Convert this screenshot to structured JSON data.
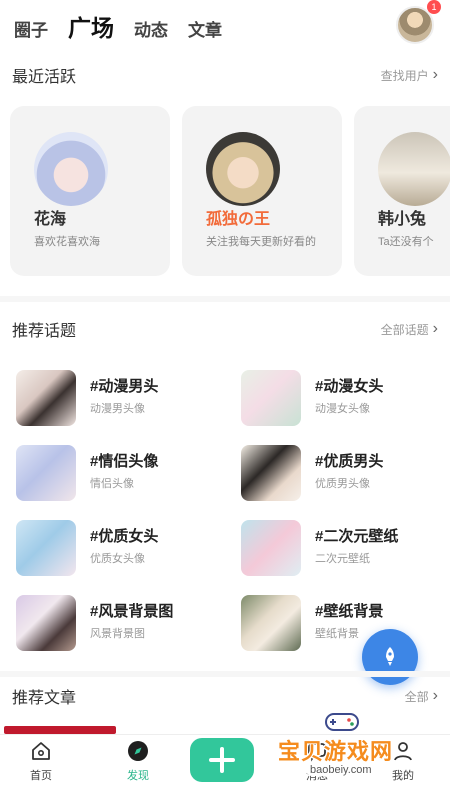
{
  "header": {
    "tabs": [
      "圈子",
      "广场",
      "动态",
      "文章"
    ],
    "active_tab": "广场",
    "notification_count": "1"
  },
  "recent": {
    "title": "最近活跃",
    "more": "查找用户",
    "users": [
      {
        "name": "花海",
        "desc": "喜欢花喜欢海",
        "highlight": false
      },
      {
        "name": "孤独の王",
        "desc": "关注我每天更新好看的",
        "highlight": true
      },
      {
        "name": "韩小兔",
        "desc": "Ta还没有个",
        "highlight": false
      }
    ]
  },
  "topics": {
    "title": "推荐话题",
    "more": "全部话题",
    "items": [
      {
        "title": "#动漫男头",
        "sub": "动漫男头像"
      },
      {
        "title": "#动漫女头",
        "sub": "动漫女头像"
      },
      {
        "title": "#情侣头像",
        "sub": "情侣头像"
      },
      {
        "title": "#优质男头",
        "sub": "优质男头像"
      },
      {
        "title": "#优质女头",
        "sub": "优质女头像"
      },
      {
        "title": "#二次元壁纸",
        "sub": "二次元壁纸"
      },
      {
        "title": "#风景背景图",
        "sub": "风景背景图"
      },
      {
        "title": "#壁纸背景",
        "sub": "壁纸背景"
      }
    ]
  },
  "articles": {
    "title": "推荐文章",
    "more": "全部"
  },
  "nav": {
    "home": "首页",
    "discover": "发现",
    "messages": "消息",
    "mine": "我的"
  },
  "watermark": {
    "name": "宝贝游戏网",
    "url": "baobeiy.com"
  },
  "colors": {
    "accent": "#32c79b",
    "highlight_name": "#f26b3a",
    "fab": "#3d86e6",
    "watermark": "#f58c1e"
  }
}
